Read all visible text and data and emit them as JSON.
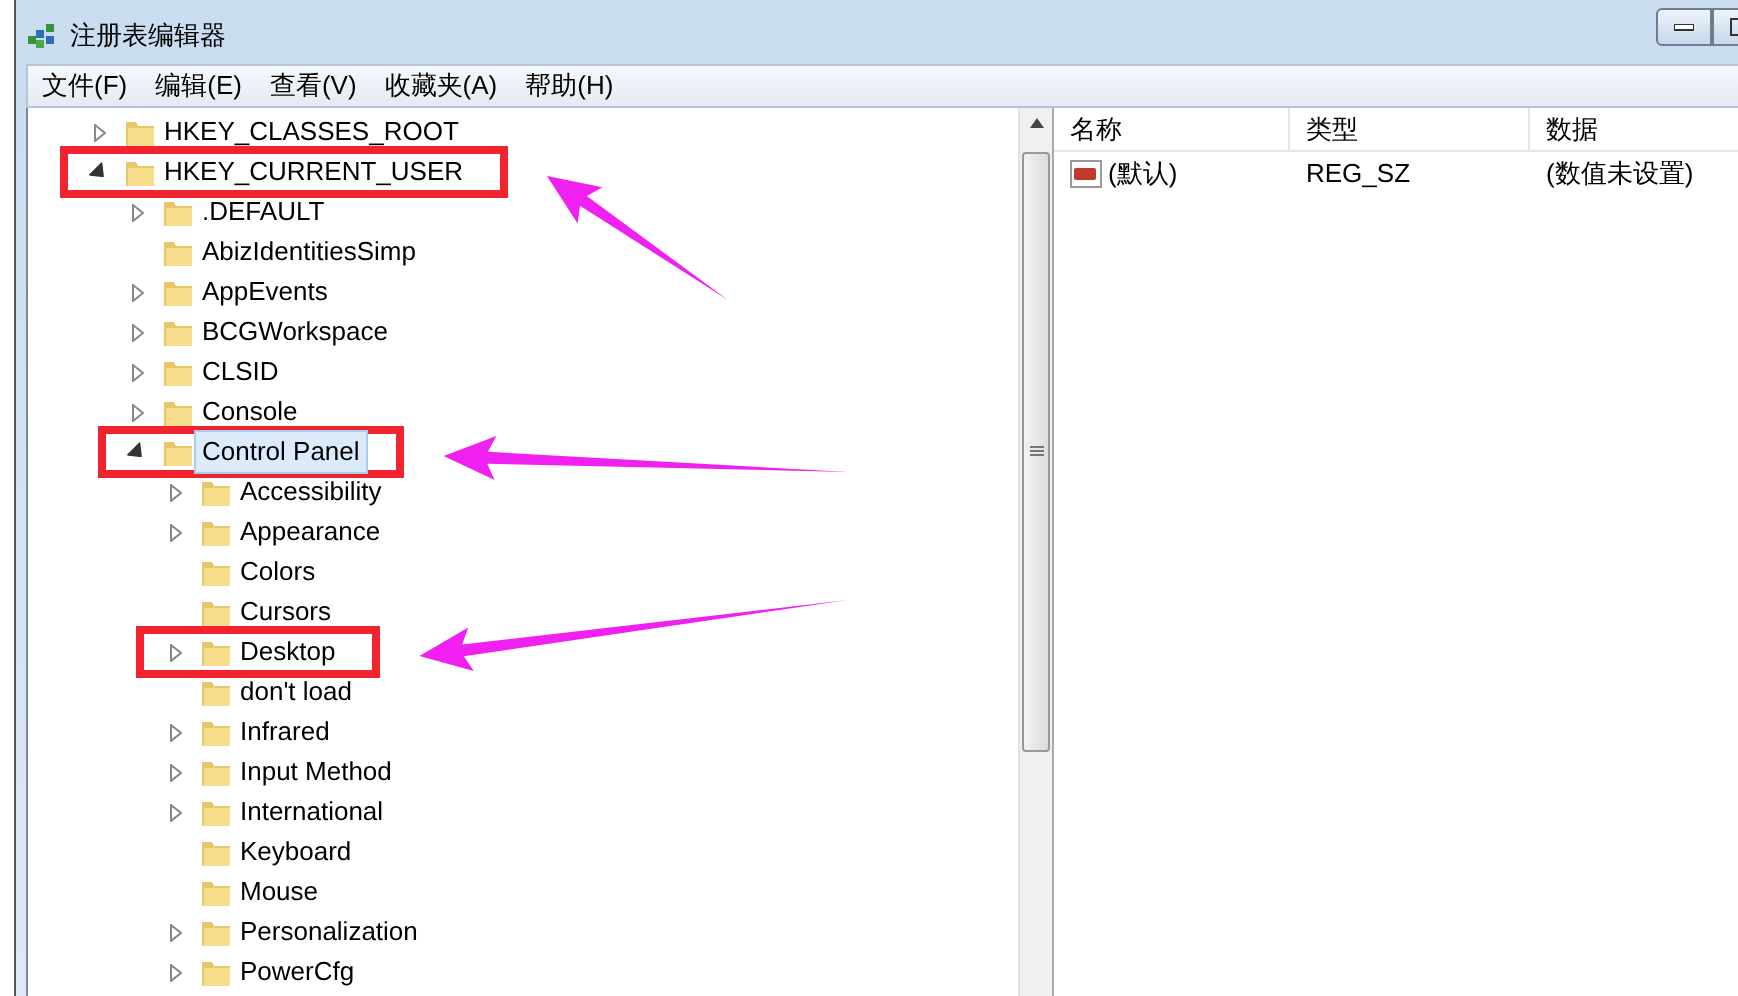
{
  "window": {
    "title": "注册表编辑器"
  },
  "menu": [
    "文件(F)",
    "编辑(E)",
    "查看(V)",
    "收藏夹(A)",
    "帮助(H)"
  ],
  "tree": [
    {
      "label": "HKEY_CLASSES_ROOT",
      "expandable": true,
      "expanded": false,
      "selected": false,
      "marked": false
    },
    {
      "label": "HKEY_CURRENT_USER",
      "expandable": true,
      "expanded": true,
      "selected": false,
      "marked": true,
      "children": [
        {
          "label": ".DEFAULT",
          "expandable": true,
          "expanded": false,
          "selected": false,
          "marked": false
        },
        {
          "label": "AbizIdentitiesSimp",
          "expandable": false,
          "selected": false,
          "marked": false
        },
        {
          "label": "AppEvents",
          "expandable": true,
          "expanded": false,
          "selected": false,
          "marked": false
        },
        {
          "label": "BCGWorkspace",
          "expandable": true,
          "expanded": false,
          "selected": false,
          "marked": false
        },
        {
          "label": "CLSID",
          "expandable": true,
          "expanded": false,
          "selected": false,
          "marked": false
        },
        {
          "label": "Console",
          "expandable": true,
          "expanded": false,
          "selected": false,
          "marked": false
        },
        {
          "label": "Control Panel",
          "expandable": true,
          "expanded": true,
          "selected": true,
          "marked": true,
          "children": [
            {
              "label": "Accessibility",
              "expandable": true,
              "expanded": false,
              "selected": false,
              "marked": false
            },
            {
              "label": "Appearance",
              "expandable": true,
              "expanded": false,
              "selected": false,
              "marked": false
            },
            {
              "label": "Colors",
              "expandable": false,
              "selected": false,
              "marked": false
            },
            {
              "label": "Cursors",
              "expandable": false,
              "selected": false,
              "marked": false
            },
            {
              "label": "Desktop",
              "expandable": true,
              "expanded": false,
              "selected": false,
              "marked": true
            },
            {
              "label": "don't load",
              "expandable": false,
              "selected": false,
              "marked": false
            },
            {
              "label": "Infrared",
              "expandable": true,
              "expanded": false,
              "selected": false,
              "marked": false
            },
            {
              "label": "Input Method",
              "expandable": true,
              "expanded": false,
              "selected": false,
              "marked": false
            },
            {
              "label": "International",
              "expandable": true,
              "expanded": false,
              "selected": false,
              "marked": false
            },
            {
              "label": "Keyboard",
              "expandable": false,
              "selected": false,
              "marked": false
            },
            {
              "label": "Mouse",
              "expandable": false,
              "selected": false,
              "marked": false
            },
            {
              "label": "Personalization",
              "expandable": true,
              "expanded": false,
              "selected": false,
              "marked": false
            },
            {
              "label": "PowerCfg",
              "expandable": true,
              "expanded": false,
              "selected": false,
              "marked": false
            }
          ]
        }
      ]
    }
  ],
  "values": {
    "columns": [
      "名称",
      "类型",
      "数据"
    ],
    "rows": [
      {
        "kind": "string",
        "name": "(默认)",
        "type": "REG_SZ",
        "data": "(数值未设置)"
      }
    ]
  }
}
